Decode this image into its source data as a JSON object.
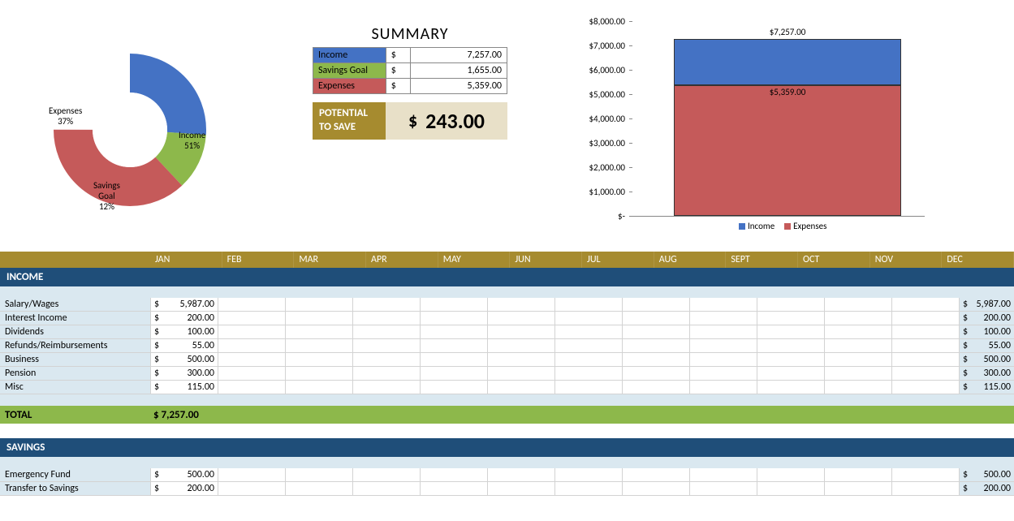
{
  "colors": {
    "income": "#4472c4",
    "savings": "#8db84b",
    "expenses": "#c55a5a",
    "header_gold": "#a68b2f",
    "header_blue": "#1f4e79"
  },
  "summary": {
    "title": "SUMMARY",
    "rows": [
      {
        "label": "Income",
        "value": "7,257.00",
        "bg": "#4472c4"
      },
      {
        "label": "Savings Goal",
        "value": "1,655.00",
        "bg": "#8db84b"
      },
      {
        "label": "Expenses",
        "value": "5,359.00",
        "bg": "#c55a5a"
      }
    ],
    "potential_label": "POTENTIAL TO SAVE",
    "potential_value": "243.00"
  },
  "donut": {
    "labels": {
      "income": "Income\n51%",
      "savings": "Savings\nGoal\n12%",
      "expenses": "Expenses\n37%"
    }
  },
  "bar_chart": {
    "y_ticks": [
      "$8,000.00",
      "$7,000.00",
      "$6,000.00",
      "$5,000.00",
      "$4,000.00",
      "$3,000.00",
      "$2,000.00",
      "$1,000.00",
      "$-"
    ],
    "income_label": "$7,257.00",
    "expenses_label": "$5,359.00",
    "legend_income": "Income",
    "legend_expenses": "Expenses"
  },
  "months": [
    "JAN",
    "FEB",
    "MAR",
    "APR",
    "MAY",
    "JUN",
    "JUL",
    "AUG",
    "SEPT",
    "OCT",
    "NOV",
    "DEC"
  ],
  "income_header": "INCOME",
  "income_rows": [
    {
      "label": "Salary/Wages",
      "jan": "5,987.00",
      "total": "5,987.00"
    },
    {
      "label": "Interest Income",
      "jan": "200.00",
      "total": "200.00"
    },
    {
      "label": "Dividends",
      "jan": "100.00",
      "total": "100.00"
    },
    {
      "label": "Refunds/Reimbursements",
      "jan": "55.00",
      "total": "55.00"
    },
    {
      "label": "Business",
      "jan": "500.00",
      "total": "500.00"
    },
    {
      "label": "Pension",
      "jan": "300.00",
      "total": "300.00"
    },
    {
      "label": "Misc",
      "jan": "115.00",
      "total": "115.00"
    }
  ],
  "total_label": "TOTAL",
  "income_total": "$ 7,257.00",
  "savings_header": "SAVINGS",
  "savings_rows": [
    {
      "label": "Emergency Fund",
      "jan": "500.00",
      "total": "500.00"
    },
    {
      "label": "Transfer to Savings",
      "jan": "200.00",
      "total": "200.00"
    }
  ],
  "chart_data": [
    {
      "type": "pie",
      "title": "",
      "series": [
        {
          "name": "Income",
          "value": 51
        },
        {
          "name": "Savings Goal",
          "value": 12
        },
        {
          "name": "Expenses",
          "value": 37
        }
      ]
    },
    {
      "type": "bar",
      "categories": [
        ""
      ],
      "series": [
        {
          "name": "Income",
          "values": [
            7257.0
          ]
        },
        {
          "name": "Expenses",
          "values": [
            5359.0
          ]
        }
      ],
      "ylim": [
        0,
        8000
      ],
      "ylabel": "",
      "xlabel": ""
    }
  ]
}
